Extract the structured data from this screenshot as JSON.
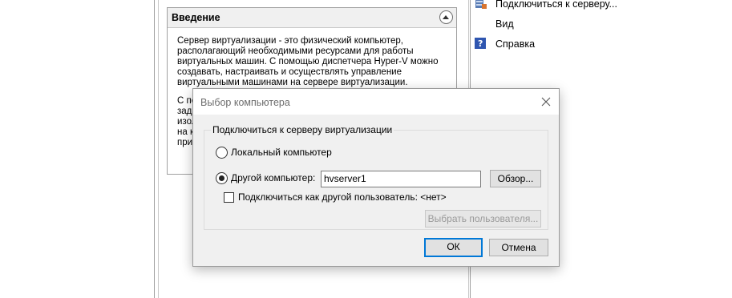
{
  "background": {
    "intro": {
      "title": "Введение",
      "paragraph1": "Сервер виртуализации - это физический компьютер, располагающий необходимыми ресурсами для работы виртуальных машин. С помощью диспетчера Hyper-V можно создавать, настраивать и осуществлять управление виртуальными машинами на сервере виртуализации.",
      "paragraph2_fragments": [
        "С по",
        "зада",
        "изол",
        "на к",
        "при"
      ]
    },
    "actions": [
      {
        "label": "Подключиться к серверу...",
        "icon": "server-connect-icon"
      },
      {
        "label": "Вид",
        "icon": "view-icon"
      },
      {
        "label": "Справка",
        "icon": "help-icon"
      }
    ]
  },
  "dialog": {
    "title": "Выбор компьютера",
    "group_label": "Подключиться к серверу виртуализации",
    "option_local": "Локальный компьютер",
    "option_other": "Другой компьютер:",
    "other_value": "hvserver1",
    "browse_label": "Обзор...",
    "connect_as_label": "Подключиться как другой пользователь: <нет>",
    "select_user_label": "Выбрать пользователя...",
    "ok_label": "ОК",
    "cancel_label": "Отмена",
    "selected_option": "other",
    "connect_as_checked": false
  },
  "colors": {
    "accent": "#0078d7",
    "dialog_bg": "#f0f0f0"
  }
}
